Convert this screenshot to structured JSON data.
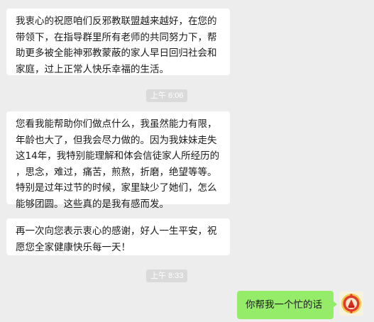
{
  "messages": {
    "m1": {
      "lines": [
        "我衷心的祝愿咱们反邪教联盟越来越好，在您的",
        "带领下，在指导群里所有老师的共同努力下，帮",
        "助更多被全能神邪教蒙蔽的家人早日回归社会和",
        "家庭，过上正常人快乐幸福的生活。"
      ]
    },
    "time1": "上午 6:06",
    "m2": {
      "lines": [
        "您看我能帮助你们做点什么，我虽然能力有限，",
        "年龄也大了，但我会尽力做的。因为我妹妹走失",
        "这14年，我特别能理解和体会信徒家人所经历的",
        "，思念，难过，痛苦，煎熬，折磨，绝望等等。",
        "特别是过年过节的时候，家里缺少了她们，怎么",
        "能够团圆。这些真的是我有感而发。"
      ]
    },
    "m3": {
      "lines": [
        "再一次向您表示衷心的感谢，好人一生平安，祝",
        "愿您全家健康快乐每一天！"
      ]
    },
    "time2": "上午 8:33",
    "me1": "你帮我一个忙的话"
  }
}
